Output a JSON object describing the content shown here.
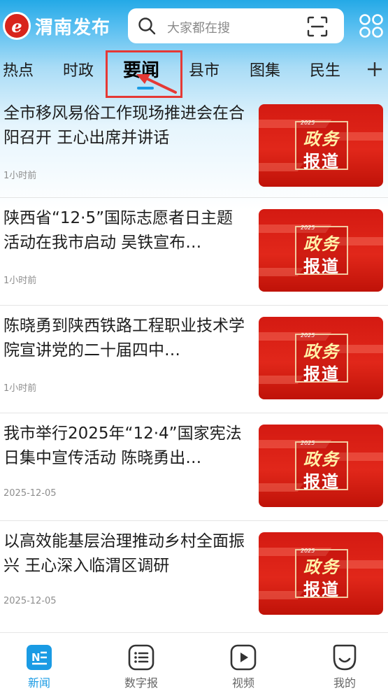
{
  "app": {
    "logo_letter": "e",
    "title": "渭南发布"
  },
  "search": {
    "placeholder": "大家都在搜"
  },
  "tabs": [
    {
      "label": "热点"
    },
    {
      "label": "时政"
    },
    {
      "label": "要闻",
      "active": true
    },
    {
      "label": "县市"
    },
    {
      "label": "图集"
    },
    {
      "label": "民生"
    }
  ],
  "thumbnail": {
    "line1": "政务",
    "line2": "报道",
    "tag": "2025"
  },
  "news": [
    {
      "title": "全市移风易俗工作现场推进会在合阳召开 王心出席并讲话",
      "time": "1小时前"
    },
    {
      "title": "陕西省“12·5”国际志愿者日主题活动在我市启动 吴铁宣布…",
      "time": "1小时前"
    },
    {
      "title": "陈晓勇到陕西铁路工程职业技术学院宣讲党的二十届四中…",
      "time": "1小时前"
    },
    {
      "title": "我市举行2025年“12·4”国家宪法日集中宣传活动 陈晓勇出…",
      "time": "2025-12-05"
    },
    {
      "title": "以高效能基层治理推动乡村全面振兴 王心深入临渭区调研",
      "time": "2025-12-05"
    }
  ],
  "bottom_nav": [
    {
      "label": "新闻",
      "icon": "news-icon",
      "active": true
    },
    {
      "label": "数字报",
      "icon": "digital-paper-icon"
    },
    {
      "label": "视频",
      "icon": "video-icon"
    },
    {
      "label": "我的",
      "icon": "profile-icon"
    }
  ],
  "colors": {
    "accent": "#1a9be4",
    "annotation": "#e53935",
    "thumb_red": "#d41a12"
  }
}
